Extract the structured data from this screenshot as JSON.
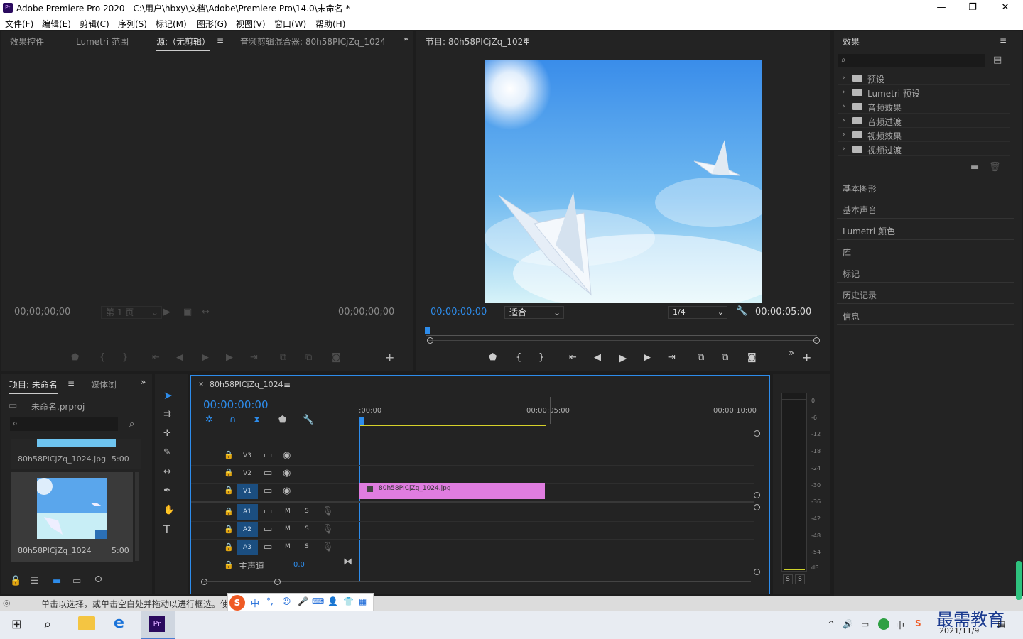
{
  "window": {
    "app_icon": "Pr",
    "title": "Adobe Premiere Pro 2020 - C:\\用户\\hbxy\\文档\\Adobe\\Premiere Pro\\14.0\\未命名 *",
    "minimize": "—",
    "maximize": "❐",
    "close": "✕"
  },
  "menu": [
    "文件(F)",
    "编辑(E)",
    "剪辑(C)",
    "序列(S)",
    "标记(M)",
    "图形(G)",
    "视图(V)",
    "窗口(W)",
    "帮助(H)"
  ],
  "source_panel": {
    "tabs": [
      "效果控件",
      "Lumetri 范围",
      "源:（无剪辑）",
      "音频剪辑混合器: 80h58PICjZq_1024"
    ],
    "timecode_in": "00;00;00;00",
    "timecode_out": "00;00;00;00",
    "page_dropdown": "第 1 页"
  },
  "program_panel": {
    "tab": "节目: 80h58PICjZq_1024",
    "timecode": "00:00:00:00",
    "fit": "适合",
    "quality": "1/4",
    "duration": "00:00:05:00"
  },
  "effects_panel": {
    "title": "效果",
    "tree": [
      "预设",
      "Lumetri 预设",
      "音频效果",
      "音频过渡",
      "视频效果",
      "视频过渡"
    ],
    "sections": [
      "基本图形",
      "基本声音",
      "Lumetri 颜色",
      "库",
      "标记",
      "历史记录",
      "信息"
    ]
  },
  "project_panel": {
    "tab": "项目: 未命名",
    "tab2": "媒体浏",
    "project_file": "未命名.prproj",
    "items": [
      {
        "name": "80h58PICjZq_1024.jpg",
        "duration": "5:00"
      },
      {
        "name": "80h58PICjZq_1024",
        "duration": "5:00"
      }
    ]
  },
  "timeline": {
    "tab": "80h58PICjZq_1024",
    "timecode": "00:00:00:00",
    "ruler": [
      ":00:00",
      "00:00:05:00",
      "00:00:10:00"
    ],
    "video_tracks": [
      "V3",
      "V2",
      "V1"
    ],
    "audio_tracks": [
      "A1",
      "A2",
      "A3"
    ],
    "master": "主声道",
    "master_value": "0.0",
    "clip_name": "80h58PICjZq_1024.jpg",
    "mute": "M",
    "solo": "S"
  },
  "meter": {
    "scale": [
      "0",
      "-6",
      "-12",
      "-18",
      "-24",
      "-30",
      "-36",
      "-42",
      "-48",
      "-54",
      "dB"
    ],
    "solo_buttons": [
      "S",
      "S"
    ]
  },
  "status": {
    "text": "单击以选择，或单击空白处并拖动以进行框选。使用 Shift、Alt 和 Ctrl 可获得其他选项。",
    "ime": "中"
  },
  "taskbar": {
    "date": "2021/11/9",
    "watermark": "最需教育",
    "tray_ime": "中"
  }
}
